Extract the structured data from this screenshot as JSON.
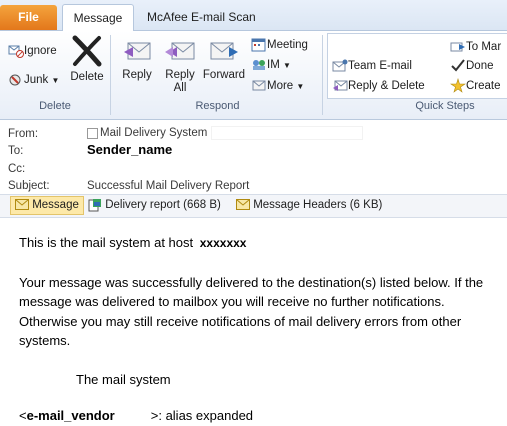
{
  "tabs": {
    "file": "File",
    "message": "Message",
    "mcafee": "McAfee E-mail Scan"
  },
  "ribbon": {
    "delete_group": {
      "ignore": "Ignore",
      "junk": "Junk",
      "delete": "Delete",
      "label": "Delete"
    },
    "respond_group": {
      "reply": "Reply",
      "reply_all_1": "Reply",
      "reply_all_2": "All",
      "forward": "Forward",
      "meeting": "Meeting",
      "im": "IM",
      "more": "More",
      "label": "Respond"
    },
    "quick_steps": {
      "team_email": "Team E-mail",
      "reply_delete": "Reply & Delete",
      "to_manager": "To Mar",
      "done": "Done",
      "create": "Create",
      "label": "Quick Steps"
    }
  },
  "header": {
    "from_label": "From:",
    "from_value": "Mail Delivery System",
    "to_label": "To:",
    "to_value": "Sender_name",
    "cc_label": "Cc:",
    "subject_label": "Subject:",
    "subject_value": "Successful Mail Delivery Report"
  },
  "attachments": {
    "message": "Message",
    "delivery_report": "Delivery report (668 B)",
    "message_headers": "Message Headers (6 KB)"
  },
  "body": {
    "line1_prefix": "This is the mail system at host",
    "host": "xxxxxxx",
    "para2": "Your message was successfully delivered to the destination(s) listed below. If the message was delivered to mailbox you will receive no further notifications. Otherwise you may still receive notifications of mail delivery errors from other systems.",
    "signature": "The mail system",
    "recipient_prefix": "<",
    "recipient": "e-mail_vendor",
    "recipient_suffix": ">: alias expanded"
  },
  "colors": {
    "file_tab": "#e3771b",
    "ribbon_bg": "#e8eef7",
    "accent_blue": "#2f6db5"
  }
}
